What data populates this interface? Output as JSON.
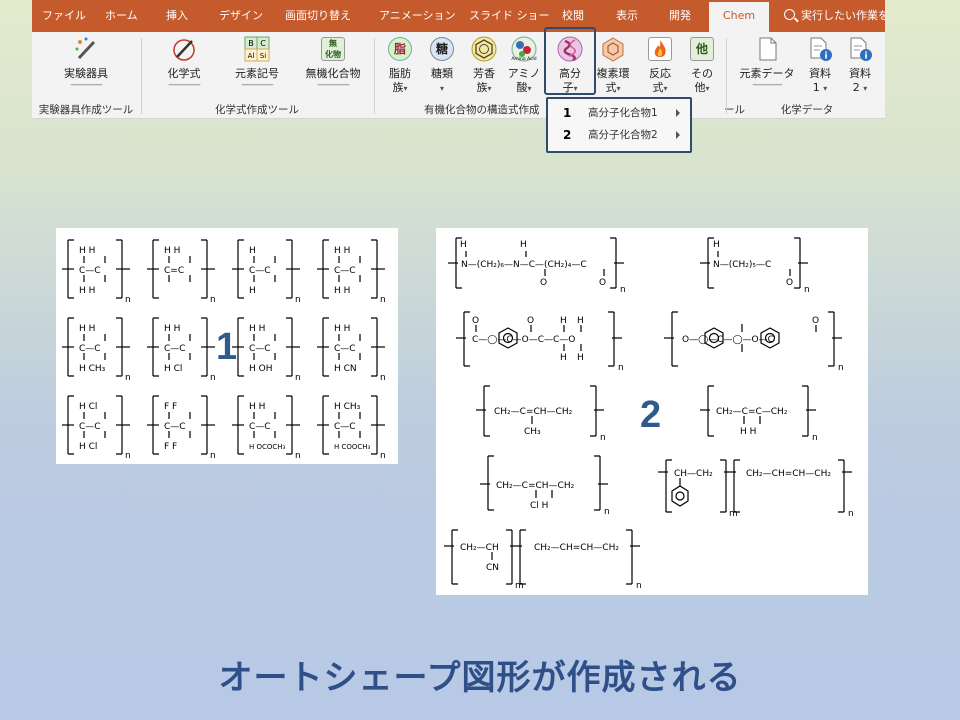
{
  "tabs": [
    "ファイル",
    "ホーム",
    "挿入",
    "デザイン",
    "画面切り替え",
    "アニメーション",
    "スライド ショー",
    "校閲",
    "表示",
    "開発",
    "Chem"
  ],
  "active_tab": "Chem",
  "tell_me": "実行したい作業を",
  "buttons": {
    "apparatus": "実験器具",
    "chemical_formula": "化学式",
    "element_symbol": "元素記号",
    "inorganic": "無機化合物",
    "fatty_line1": "脂肪",
    "fatty_line2": "族",
    "sugar": "糖類",
    "aromatic_line1": "芳香",
    "aromatic_line2": "族",
    "amino_line1": "アミノ",
    "amino_line2": "酸",
    "polymer_line1": "高分",
    "polymer_line2": "子",
    "heterocycle_line1": "複素環",
    "heterocycle_line2": "式",
    "reaction_line1": "反応",
    "reaction_line2": "式",
    "other_line1": "その",
    "other_line2": "他",
    "element_data": "元素データ",
    "material1_line1": "資料",
    "material1_line2": "1",
    "material2_line1": "資料",
    "material2_line2": "2"
  },
  "icon_glyphs": {
    "element": [
      "B",
      "C",
      "Al",
      "Si"
    ],
    "inorganic": "無\n化物",
    "fatty": "脂",
    "sugar": "糖",
    "other": "他",
    "amino": "Amino Acid"
  },
  "groups": {
    "apparatus": "実験器具作成ツール",
    "formula": "化学式作成ツール",
    "organic": "有機化合物の構造式作成",
    "organic_tail": "ール",
    "chemdata": "化学データ"
  },
  "dropdown": [
    {
      "num": "1",
      "label": "高分子化合物1"
    },
    {
      "num": "2",
      "label": "高分子化合物2"
    }
  ],
  "markers": {
    "one": "1",
    "two": "2"
  },
  "caption": "オートシェープ図形が作成される",
  "colors": {
    "tab_bar": "#c55a2c",
    "highlight": "#2f4d6b",
    "caption": "#2e4f88",
    "marker": "#2f5b8c"
  },
  "structures_1": [
    {
      "top": "H H",
      "mid": "C—C",
      "bot": "H H"
    },
    {
      "top": "H H",
      "mid": "C=C",
      "bot": ""
    },
    {
      "top": "H",
      "mid": "C—C",
      "bot": "H"
    },
    {
      "top": "H H",
      "mid": "C—C",
      "bot": "H H"
    },
    {
      "top": "H H",
      "mid": "C—C",
      "bot": "H CH₃"
    },
    {
      "top": "H H",
      "mid": "C—C",
      "bot": "H Cl"
    },
    {
      "top": "H H",
      "mid": "C—C",
      "bot": "H OH"
    },
    {
      "top": "H H",
      "mid": "C—C",
      "bot": "H CN"
    },
    {
      "top": "H Cl",
      "mid": "C—C",
      "bot": "H Cl"
    },
    {
      "top": "F F",
      "mid": "C—C",
      "bot": "F F"
    },
    {
      "top": "H H",
      "mid": "C—C",
      "bot": "H OCOCH₃"
    },
    {
      "top": "H CH₃",
      "mid": "C—C",
      "bot": "H COOCH₃"
    }
  ],
  "structures_2": {
    "nylon66": "N—(CH₂)₆—N—C—(CH₂)₄—C",
    "nylon6": "N—(CH₂)₅—C",
    "pet": "C—◯—C—O—C—C—O",
    "pc": "O—◯—C—◯—O—C",
    "isoprene": "CH₂—C=CH—CH₂",
    "isoprene_sub": "CH₃",
    "butadiene": "CH₂—C=C—CH₂",
    "butadiene_sub": "H  H",
    "chloroprene": "CH₂—C=CH—CH₂",
    "chloroprene_sub": "Cl H",
    "sbr_a": "CH—CH₂",
    "sbr_b": "CH₂—CH=CH—CH₂",
    "nbr_a": "CH₂—CH",
    "nbr_a_sub": "CN",
    "nbr_b": "CH₂—CH=CH—CH₂",
    "h": "H",
    "o": "O",
    "n": "n",
    "m": "m"
  }
}
